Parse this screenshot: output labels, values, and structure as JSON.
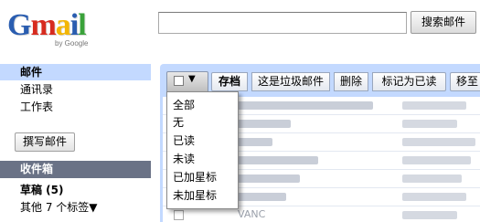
{
  "logo": {
    "wordmark": [
      "G",
      "m",
      "a",
      "i",
      "l"
    ],
    "byline": "by Google",
    "colors": [
      "#2a5db0",
      "#d72b1f",
      "#f3b605",
      "#2a5db0",
      "#3aa23a"
    ]
  },
  "search": {
    "value": "",
    "button_label": "搜索邮件"
  },
  "sidebar": {
    "items": [
      {
        "label": "邮件"
      },
      {
        "label": "通讯录"
      },
      {
        "label": "工作表"
      }
    ],
    "compose_label": "撰写邮件",
    "inbox_label": "收件箱",
    "drafts_label": "草稿 (5)",
    "more_labels": "其他 7 个标签▼"
  },
  "toolbar": {
    "archive": "存档",
    "spam": "这是垃圾邮件",
    "delete": "删除",
    "mark_read": "标记为已读",
    "move": "移至"
  },
  "select_menu": {
    "items": [
      "全部",
      "无",
      "已读",
      "未读",
      "已加星标",
      "未加星标"
    ]
  },
  "email_list": {
    "partial_text": "VANC"
  },
  "colors": {
    "accent_blue": "#c3d9ff",
    "inbox_highlight": "#6a7286"
  }
}
